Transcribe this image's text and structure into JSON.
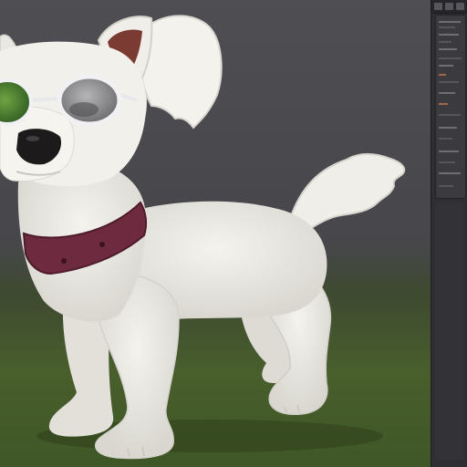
{
  "colors": {
    "fur": "#ecebe5",
    "fur_shade": "#cfcdc6",
    "collar": "#6e2a3f",
    "lens_left": "#3f7a2c",
    "lens_right": "#8c8c8e",
    "nose": "#1c1a1b",
    "ear_inner": "#7b3b33",
    "panel_bg": "#2f2f33",
    "viewport_top": "#4e4e53",
    "ground": "#485f2c"
  },
  "icons": {
    "panel_buttons": [
      "close-icon",
      "minimize-icon",
      "menu-icon"
    ]
  }
}
